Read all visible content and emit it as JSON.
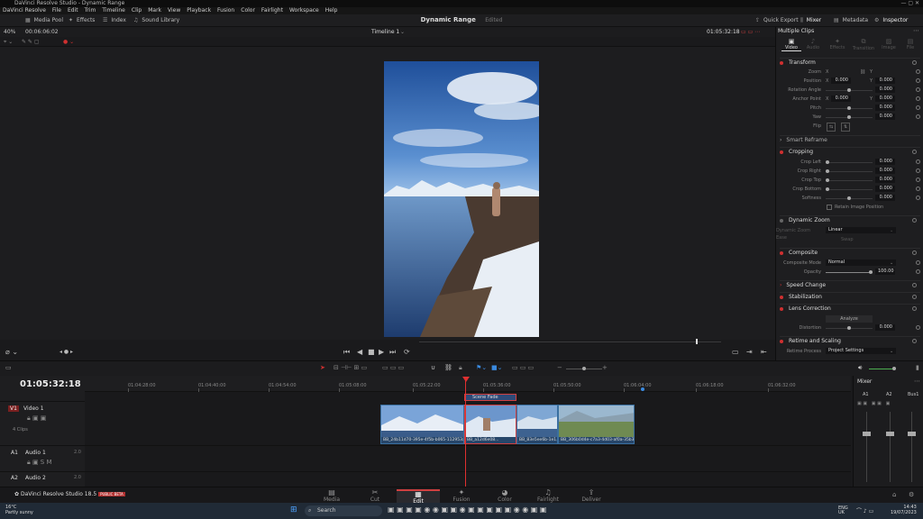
{
  "window": {
    "title": "DaVinci Resolve Studio - Dynamic Range"
  },
  "menu": [
    "DaVinci Resolve",
    "File",
    "Edit",
    "Trim",
    "Timeline",
    "Clip",
    "Mark",
    "View",
    "Playback",
    "Fusion",
    "Color",
    "Fairlight",
    "Workspace",
    "Help"
  ],
  "toolbar": {
    "media_pool": "Media Pool",
    "effects": "Effects",
    "index": "Index",
    "sound_library": "Sound Library",
    "project_title": "Dynamic Range",
    "project_status": "Edited",
    "quick_export": "Quick Export",
    "mixer": "Mixer",
    "metadata": "Metadata",
    "inspector": "Inspector"
  },
  "viewer": {
    "zoom": "40%",
    "source_tc": "00:06:06:02",
    "timeline_name": "Timeline 1",
    "record_tc": "01:05:32:18"
  },
  "inspector": {
    "title": "Multiple Clips",
    "tabs": [
      "Video",
      "Audio",
      "Effects",
      "Transition",
      "Image",
      "File"
    ],
    "transform": {
      "label": "Transform",
      "zoom_label": "Zoom",
      "zoom_x": "",
      "zoom_y": "",
      "x": "X",
      "y": "Y",
      "position_label": "Position",
      "position_x": "0.000",
      "position_y": "0.000",
      "rotation_label": "Rotation Angle",
      "rotation": "0.000",
      "anchor_label": "Anchor Point",
      "anchor_x": "0.000",
      "anchor_y": "0.000",
      "pitch_label": "Pitch",
      "pitch": "0.000",
      "yaw_label": "Yaw",
      "yaw": "0.000",
      "flip_label": "Flip"
    },
    "smart_reframe": "Smart Reframe",
    "cropping": {
      "label": "Cropping",
      "left_label": "Crop Left",
      "left": "0.000",
      "right_label": "Crop Right",
      "right": "0.000",
      "top_label": "Crop Top",
      "top": "0.000",
      "bottom_label": "Crop Bottom",
      "bottom": "0.000",
      "softness_label": "Softness",
      "softness": "0.000",
      "retain": "Retain Image Position"
    },
    "dynamic_zoom": {
      "label": "Dynamic Zoom",
      "ease_label": "Dynamic Zoom Ease",
      "ease": "Linear",
      "swap": "Swap"
    },
    "composite": {
      "label": "Composite",
      "mode_label": "Composite Mode",
      "mode": "Normal",
      "opacity_label": "Opacity",
      "opacity": "100.00"
    },
    "speed_change": "Speed Change",
    "stabilization": "Stabilization",
    "lens": {
      "label": "Lens Correction",
      "analyze": "Analyze",
      "distortion_label": "Distortion",
      "distortion": "0.000"
    },
    "retime": {
      "label": "Retime and Scaling",
      "process_label": "Retime Process",
      "process": "Project Settings"
    }
  },
  "timeline": {
    "timecode": "01:05:32:18",
    "ruler": [
      "01:04:28:00",
      "01:04:40:00",
      "01:04:54:00",
      "01:05:08:00",
      "01:05:22:00",
      "01:05:36:00",
      "01:05:50:00",
      "01:06:04:00",
      "01:06:18:00",
      "01:06:32:00"
    ],
    "v1": {
      "tag": "V1",
      "name": "Video 1",
      "count": "4 Clips"
    },
    "a1": {
      "tag": "A1",
      "name": "Audio 1",
      "ch": "2.0"
    },
    "a2": {
      "tag": "A2",
      "name": "Audio 2",
      "ch": "2.0"
    },
    "title_clip": "Scene Fade",
    "clips": [
      "BB_24b11d70-395e-4f5b-b065-112953a8...",
      "BB_a12d6e08...",
      "BB_83e5ee6b-1e1...",
      "BB_306b0d4e-c7a3-4d03-af0a-35b36..."
    ]
  },
  "mixer": {
    "title": "Mixer",
    "channels": [
      "A1",
      "A2",
      "Bus1"
    ]
  },
  "pages": [
    "Media",
    "Cut",
    "Edit",
    "Fusion",
    "Color",
    "Fairlight",
    "Deliver"
  ],
  "branding": {
    "app": "DaVinci Resolve Studio 18.5",
    "badge": "PUBLIC BETA"
  },
  "taskbar": {
    "temp": "16°C",
    "weather": "Partly sunny",
    "search": "Search",
    "lang": "ENG",
    "region": "UK",
    "time": "14:43",
    "date": "19/07/2023"
  }
}
